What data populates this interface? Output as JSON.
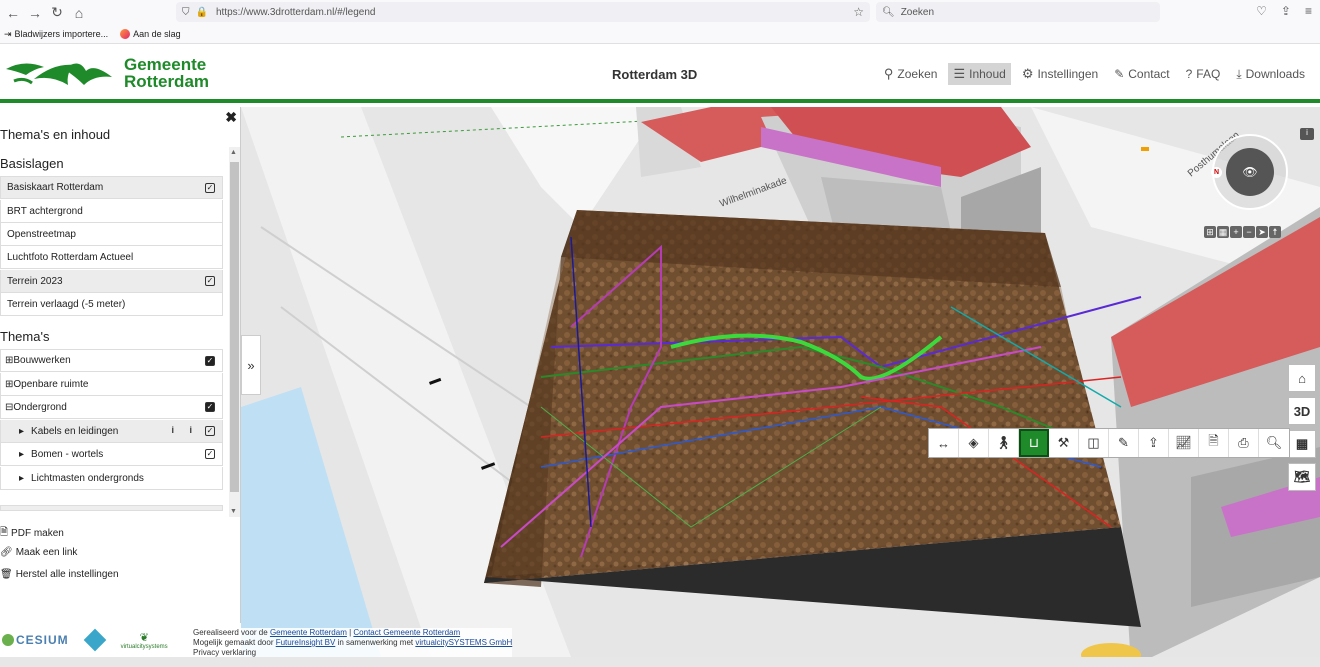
{
  "browser": {
    "url": "https://www.3drotterdam.nl/#/legend",
    "search_placeholder": "Zoeken",
    "bookmarks": [
      "Bladwijzers importere...",
      "Aan de slag"
    ]
  },
  "header": {
    "logo_line1": "Gemeente",
    "logo_line2": "Rotterdam",
    "title": "Rotterdam 3D",
    "nav": [
      {
        "label": "Zoeken",
        "icon": "search-icon"
      },
      {
        "label": "Inhoud",
        "icon": "list-icon",
        "active": true
      },
      {
        "label": "Instellingen",
        "icon": "gear-icon"
      },
      {
        "label": "Contact",
        "icon": "edit-icon"
      },
      {
        "label": "FAQ",
        "icon": "question-icon"
      },
      {
        "label": "Downloads",
        "icon": "download-icon"
      }
    ]
  },
  "sidebar": {
    "title": "Thema's en inhoud",
    "basislagen_heading": "Basislagen",
    "basislagen": [
      {
        "label": "Basiskaart Rotterdam",
        "checked": true
      },
      {
        "label": "BRT achtergrond",
        "checked": false
      },
      {
        "label": "Openstreetmap",
        "checked": false
      },
      {
        "label": "Luchtfoto Rotterdam Actueel",
        "checked": false
      },
      {
        "label": "Terrein 2023",
        "checked": true
      },
      {
        "label": "Terrein verlaagd (-5 meter)",
        "checked": false
      }
    ],
    "themas_heading": "Thema's",
    "themas": [
      {
        "label": "Bouwwerken",
        "prefix": "⊞",
        "checked": true
      },
      {
        "label": "Openbare ruimte",
        "prefix": "⊞",
        "checked": false
      },
      {
        "label": "Ondergrond",
        "prefix": "⊟",
        "checked": true
      },
      {
        "label": "Kabels en leidingen",
        "prefix": "▸",
        "checked": true,
        "info": true
      },
      {
        "label": "Bomen - wortels",
        "prefix": "▸",
        "checked": true
      },
      {
        "label": "Lichtmasten ondergronds",
        "prefix": "▸",
        "checked": false
      }
    ],
    "tools": [
      {
        "label": "PDF maken",
        "icon": "pdf-icon"
      },
      {
        "label": "Maak een link",
        "icon": "link-icon"
      },
      {
        "label": "Herstel alle instellingen",
        "icon": "reset-icon"
      }
    ]
  },
  "footer": {
    "line1_prefix": "Gerealiseerd voor de ",
    "line1_link1": "Gemeente Rotterdam",
    "line1_sep": " | ",
    "line1_link2": "Contact Gemeente Rotterdam",
    "line2_prefix": "Mogelijk gemaakt door ",
    "line2_link1": "FutureInsight BV",
    "line2_mid": " in samenwerking met ",
    "line2_link2": "virtualcitySYSTEMS GmbH",
    "line3": "Privacy verklaring",
    "logos": [
      "CESIUM",
      "virtualcitysystems"
    ]
  },
  "map": {
    "street_label_1": "Wilhelminakade",
    "street_label_2": "Posthumalaan",
    "view_3d_label": "3D",
    "compass_north": "N",
    "tools": [
      "measure-icon",
      "ground-icon",
      "walk-icon",
      "excavation-icon",
      "tools-icon",
      "split-icon",
      "brush-icon",
      "upload-icon",
      "chart-icon",
      "pdf-icon",
      "print-icon",
      "zoom-search-icon"
    ]
  },
  "colors": {
    "brand_green": "#1f8a2a"
  }
}
